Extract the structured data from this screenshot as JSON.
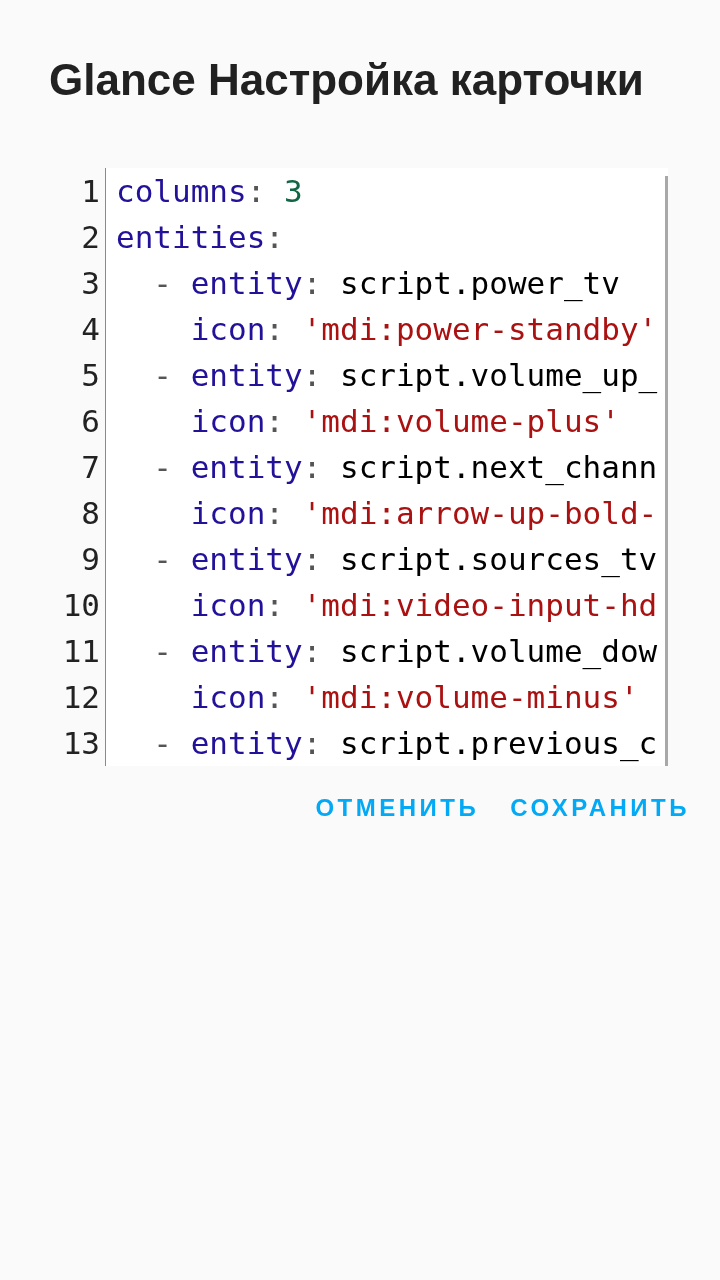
{
  "dialog": {
    "title": "Glance Настройка карточки",
    "editor": {
      "lines": [
        {
          "number": "1",
          "tokens": [
            {
              "kind": "key",
              "text": "columns"
            },
            {
              "kind": "punct",
              "text": ": "
            },
            {
              "kind": "number",
              "text": "3"
            }
          ]
        },
        {
          "number": "2",
          "tokens": [
            {
              "kind": "key",
              "text": "entities"
            },
            {
              "kind": "punct",
              "text": ":"
            }
          ]
        },
        {
          "number": "3",
          "tokens": [
            {
              "kind": "punct",
              "text": "  - "
            },
            {
              "kind": "key",
              "text": "entity"
            },
            {
              "kind": "punct",
              "text": ": "
            },
            {
              "kind": "plain",
              "text": "script.power_tv"
            }
          ]
        },
        {
          "number": "4",
          "tokens": [
            {
              "kind": "key",
              "text": "    icon"
            },
            {
              "kind": "punct",
              "text": ": "
            },
            {
              "kind": "string",
              "text": "'mdi:power-standby'"
            }
          ]
        },
        {
          "number": "5",
          "tokens": [
            {
              "kind": "punct",
              "text": "  - "
            },
            {
              "kind": "key",
              "text": "entity"
            },
            {
              "kind": "punct",
              "text": ": "
            },
            {
              "kind": "plain",
              "text": "script.volume_up_"
            }
          ]
        },
        {
          "number": "6",
          "tokens": [
            {
              "kind": "key",
              "text": "    icon"
            },
            {
              "kind": "punct",
              "text": ": "
            },
            {
              "kind": "string",
              "text": "'mdi:volume-plus'"
            }
          ]
        },
        {
          "number": "7",
          "tokens": [
            {
              "kind": "punct",
              "text": "  - "
            },
            {
              "kind": "key",
              "text": "entity"
            },
            {
              "kind": "punct",
              "text": ": "
            },
            {
              "kind": "plain",
              "text": "script.next_chann"
            }
          ]
        },
        {
          "number": "8",
          "tokens": [
            {
              "kind": "key",
              "text": "    icon"
            },
            {
              "kind": "punct",
              "text": ": "
            },
            {
              "kind": "string",
              "text": "'mdi:arrow-up-bold-"
            }
          ]
        },
        {
          "number": "9",
          "tokens": [
            {
              "kind": "punct",
              "text": "  - "
            },
            {
              "kind": "key",
              "text": "entity"
            },
            {
              "kind": "punct",
              "text": ": "
            },
            {
              "kind": "plain",
              "text": "script.sources_tv"
            }
          ]
        },
        {
          "number": "10",
          "tokens": [
            {
              "kind": "key",
              "text": "    icon"
            },
            {
              "kind": "punct",
              "text": ": "
            },
            {
              "kind": "string",
              "text": "'mdi:video-input-hd"
            }
          ]
        },
        {
          "number": "11",
          "tokens": [
            {
              "kind": "punct",
              "text": "  - "
            },
            {
              "kind": "key",
              "text": "entity"
            },
            {
              "kind": "punct",
              "text": ": "
            },
            {
              "kind": "plain",
              "text": "script.volume_dow"
            }
          ]
        },
        {
          "number": "12",
          "tokens": [
            {
              "kind": "key",
              "text": "    icon"
            },
            {
              "kind": "punct",
              "text": ": "
            },
            {
              "kind": "string",
              "text": "'mdi:volume-minus'"
            }
          ]
        },
        {
          "number": "13",
          "tokens": [
            {
              "kind": "punct",
              "text": "  - "
            },
            {
              "kind": "key",
              "text": "entity"
            },
            {
              "kind": "punct",
              "text": ": "
            },
            {
              "kind": "plain",
              "text": "script.previous_c"
            }
          ]
        }
      ]
    },
    "actions": {
      "cancel": "ОТМЕНИТЬ",
      "save": "СОХРАНИТЬ"
    }
  }
}
